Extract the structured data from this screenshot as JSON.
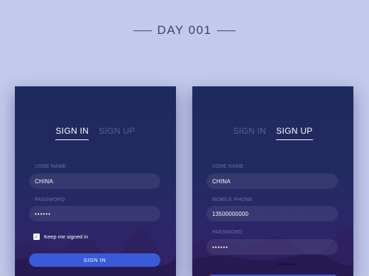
{
  "page": {
    "title": "DAY 001"
  },
  "signin_card": {
    "tabs": [
      {
        "label": "SIGN IN",
        "active": true
      },
      {
        "label": "SIGN UP",
        "active": false
      }
    ],
    "username_label": "USRE NAME",
    "username_value": "CHINA",
    "password_label": "PASSWORD",
    "password_value": "••••••",
    "keep_signed_in_label": "Keep me signed in",
    "keep_signed_in_checked": true,
    "submit_label": "SIGN IN"
  },
  "signup_card": {
    "tabs": [
      {
        "label": "SIGN IN",
        "active": false
      },
      {
        "label": "SIGN UP",
        "active": true
      }
    ],
    "username_label": "USRE NAME",
    "username_value": "CHINA",
    "phone_label": "MOBILE PHONE",
    "phone_value": "13500000000",
    "password_label": "PASSWORD",
    "password_value": "••••••"
  },
  "colors": {
    "background": "#c3c9ea",
    "card_top": "#1d2a5d",
    "card_bottom": "#332368",
    "accent_button": "#3a5bd8",
    "inactive_tab": "#5b5f9a"
  }
}
